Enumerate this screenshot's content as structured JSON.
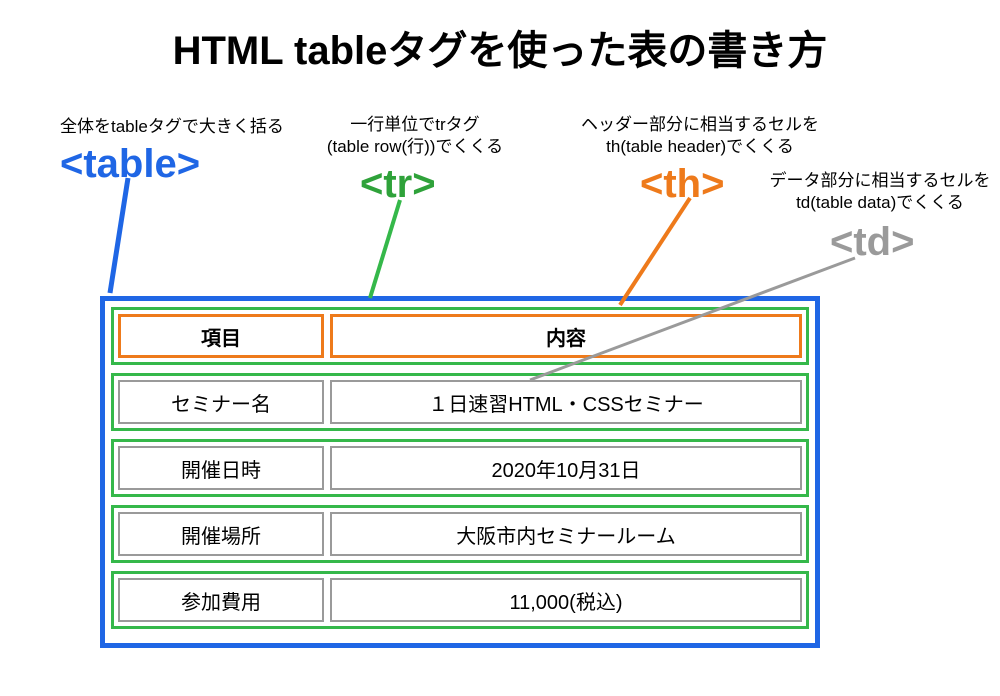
{
  "title": "HTML tableタグを使った表の書き方",
  "annotations": {
    "table_desc": "全体をtableタグで大きく括る",
    "table_tag": "<table>",
    "tr_desc1": "一行単位でtrタグ",
    "tr_desc2": "(table row(行))でくくる",
    "tr_tag": "<tr>",
    "th_desc1": "ヘッダー部分に相当するセルを",
    "th_desc2": "th(table header)でくくる",
    "th_tag": "<th>",
    "td_desc1": "データ部分に相当するセルを",
    "td_desc2": "td(table data)でくくる",
    "td_tag": "<td>"
  },
  "table": {
    "headers": {
      "col1": "項目",
      "col2": "内容"
    },
    "rows": [
      {
        "col1": "セミナー名",
        "col2": "１日速習HTML・CSSセミナー"
      },
      {
        "col1": "開催日時",
        "col2": "2020年10月31日"
      },
      {
        "col1": "開催場所",
        "col2": "大阪市内セミナールーム"
      },
      {
        "col1": "参加費用",
        "col2": "11,000(税込)"
      }
    ]
  },
  "colors": {
    "table": "#1f66e5",
    "tr": "#35b84a",
    "th": "#ee7a1b",
    "td": "#9a9a9a"
  }
}
